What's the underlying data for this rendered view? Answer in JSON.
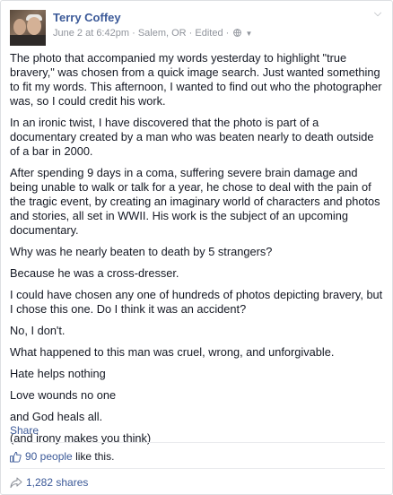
{
  "author": {
    "name": "Terry Coffey",
    "date": "June 2 at 6:42pm",
    "location": "Salem, OR",
    "edited": "Edited"
  },
  "post": {
    "paragraphs": [
      "The photo that accompanied my words yesterday to highlight \"true bravery,\" was chosen from a quick image search. Just wanted something to fit my words. This afternoon, I wanted to find out who the photographer was, so I could credit his work.",
      "In an ironic twist, I have discovered that the photo is part of a documentary created by a man who was beaten nearly to death outside of a bar in 2000.",
      "After spending 9 days in a coma, suffering severe brain damage and being unable to walk or talk for a year, he chose to deal with the pain of the tragic event, by creating an imaginary world of characters and photos and stories, all set in WWII. His work is the subject of an upcoming documentary.",
      "Why was he nearly beaten to death by 5 strangers?",
      "Because he was a cross-dresser.",
      "I could have chosen any one of hundreds of photos depicting bravery, but I chose this one. Do I think it was an accident?",
      "No, I don't.",
      "What happened to this man was cruel, wrong, and unforgivable.",
      "Hate helps nothing",
      "Love wounds no one",
      "and God heals all.",
      "(and irony makes you think)"
    ]
  },
  "actions": {
    "share_label": "Share"
  },
  "likes": {
    "count_text": "90 people",
    "suffix": "like this."
  },
  "shares": {
    "count_text": "1,282 shares"
  },
  "colors": {
    "link": "#3b5998",
    "meta": "#90949c",
    "text": "#141823"
  }
}
